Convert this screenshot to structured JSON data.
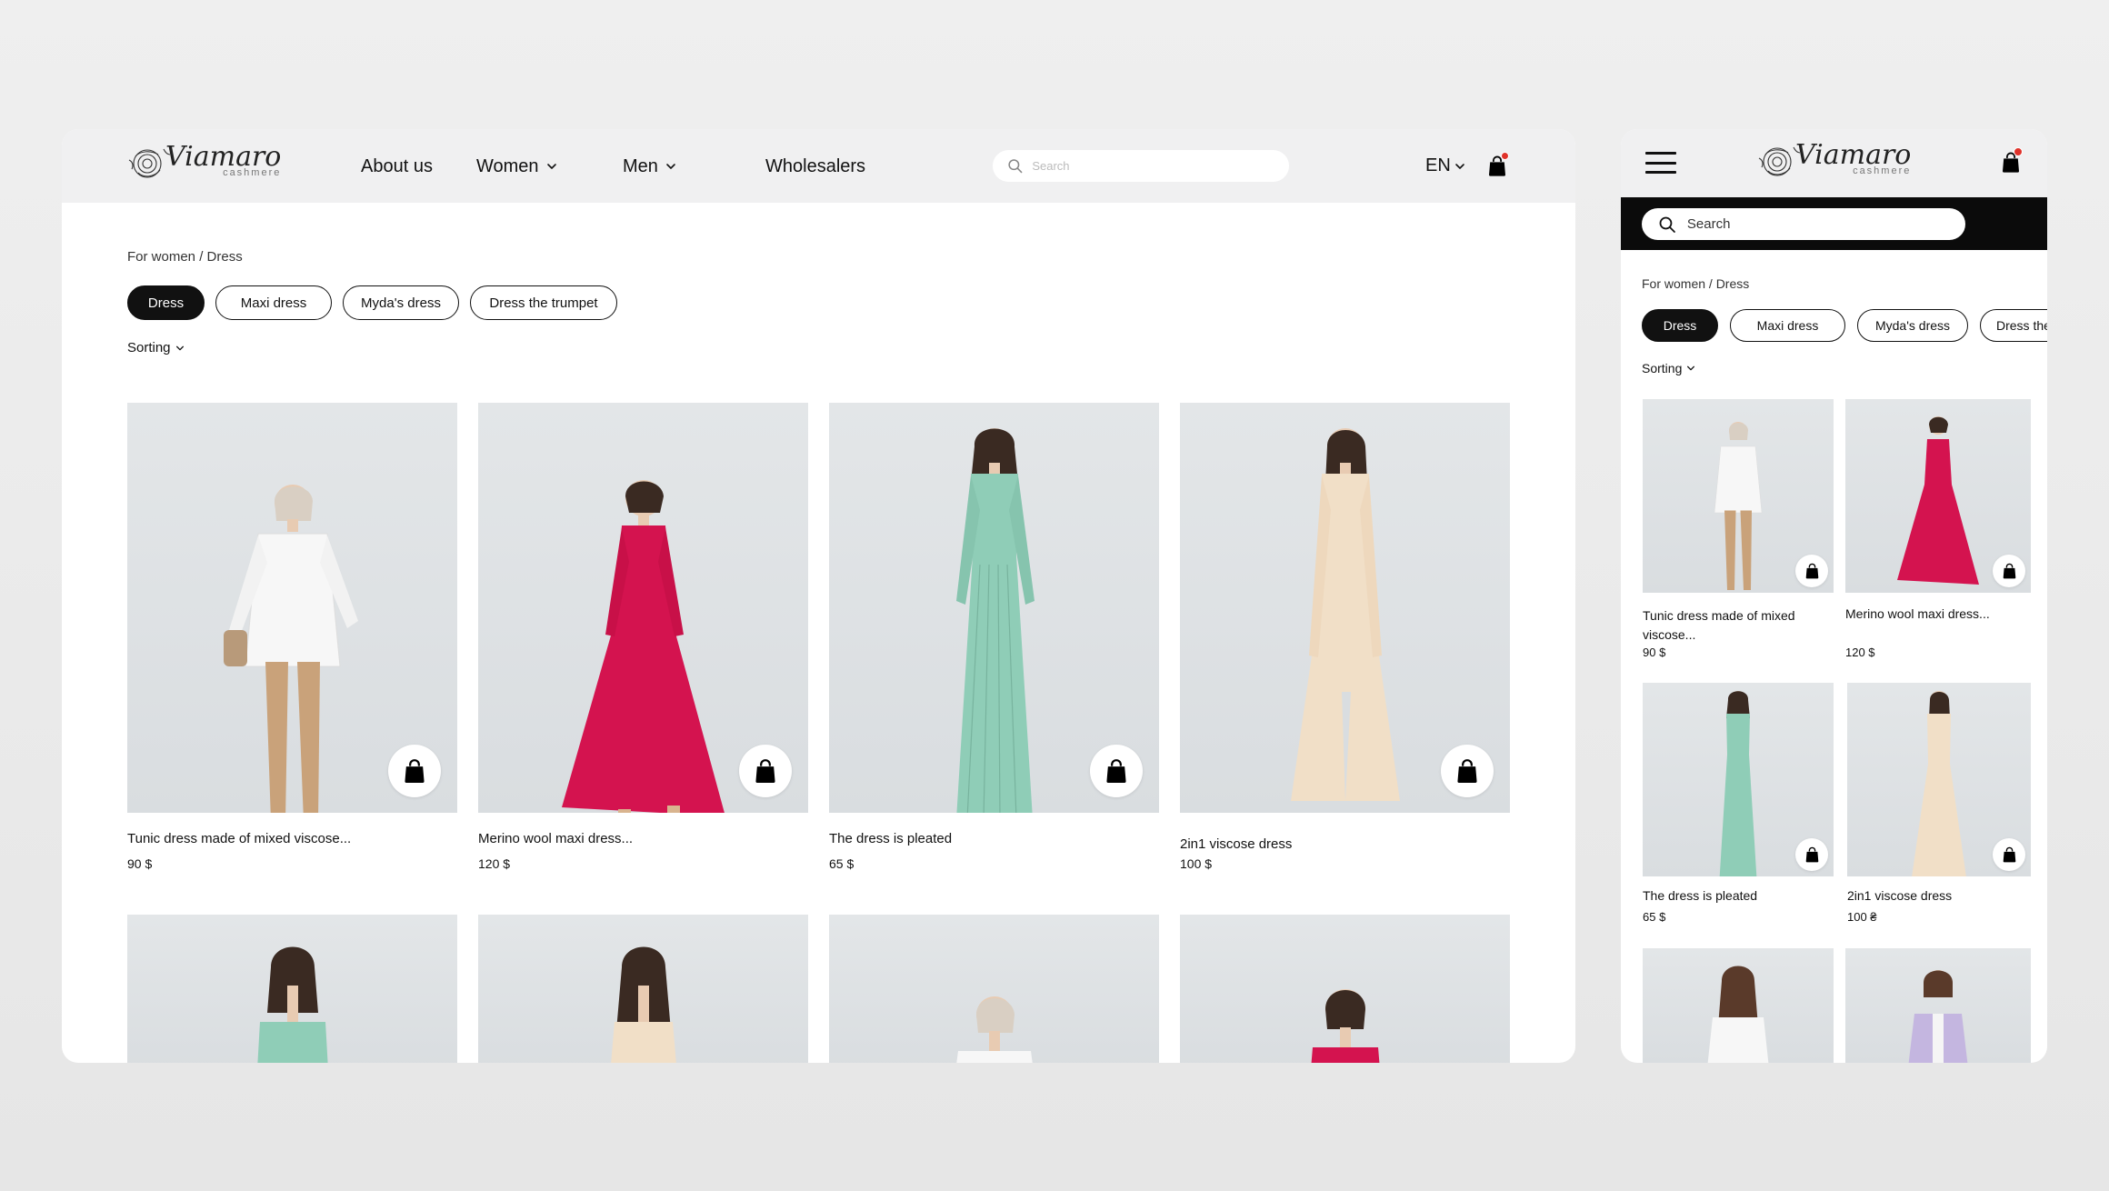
{
  "brand": {
    "name": "Viamaro",
    "sub": "cashmere"
  },
  "desktop": {
    "nav": [
      {
        "label": "About us",
        "dropdown": false
      },
      {
        "label": "Women",
        "dropdown": true
      },
      {
        "label": "Men",
        "dropdown": true
      },
      {
        "label": "Wholesalers",
        "dropdown": false
      }
    ],
    "search_placeholder": "Search",
    "lang": "EN",
    "breadcrumb": "For women / Dress",
    "chips": [
      "Dress",
      "Maxi dress",
      "Myda's dress",
      "Dress the trumpet"
    ],
    "active_chip": "Dress",
    "sorting": "Sorting",
    "products": [
      {
        "name": "Tunic dress made of mixed viscose...",
        "price": "90 $"
      },
      {
        "name": "Merino wool maxi dress...",
        "price": "120 $"
      },
      {
        "name": "The dress is pleated",
        "price": "65 $"
      },
      {
        "name": "2in1 viscose dress",
        "price": "100 $"
      }
    ]
  },
  "mobile": {
    "search_placeholder": "Search",
    "breadcrumb": "For women / Dress",
    "chips": [
      "Dress",
      "Maxi dress",
      "Myda's dress",
      "Dress the"
    ],
    "sorting": "Sorting",
    "products": [
      {
        "name": "Tunic dress made of mixed viscose...",
        "price": "90 $"
      },
      {
        "name": "Merino wool maxi dress...",
        "price": "120 $"
      },
      {
        "name": "The dress is pleated",
        "price": "65 $"
      },
      {
        "name": "2in1 viscose dress",
        "price": "100 ₴"
      }
    ]
  },
  "colors": {
    "header_bg": "#f0f0f1",
    "chip_active": "#111111",
    "cart_badge": "#e0322a",
    "mobile_search_bar": "#0b0b0b",
    "dress_white": "#f7f7f7",
    "dress_crimson": "#d4134f",
    "dress_mint": "#8fcdb7",
    "dress_cream": "#f1dfc7",
    "dress_lilac": "#c4b6e0"
  },
  "icons": [
    "rose-logo-icon",
    "search-icon",
    "chevron-down-icon",
    "shopping-bag-icon",
    "menu-icon"
  ]
}
